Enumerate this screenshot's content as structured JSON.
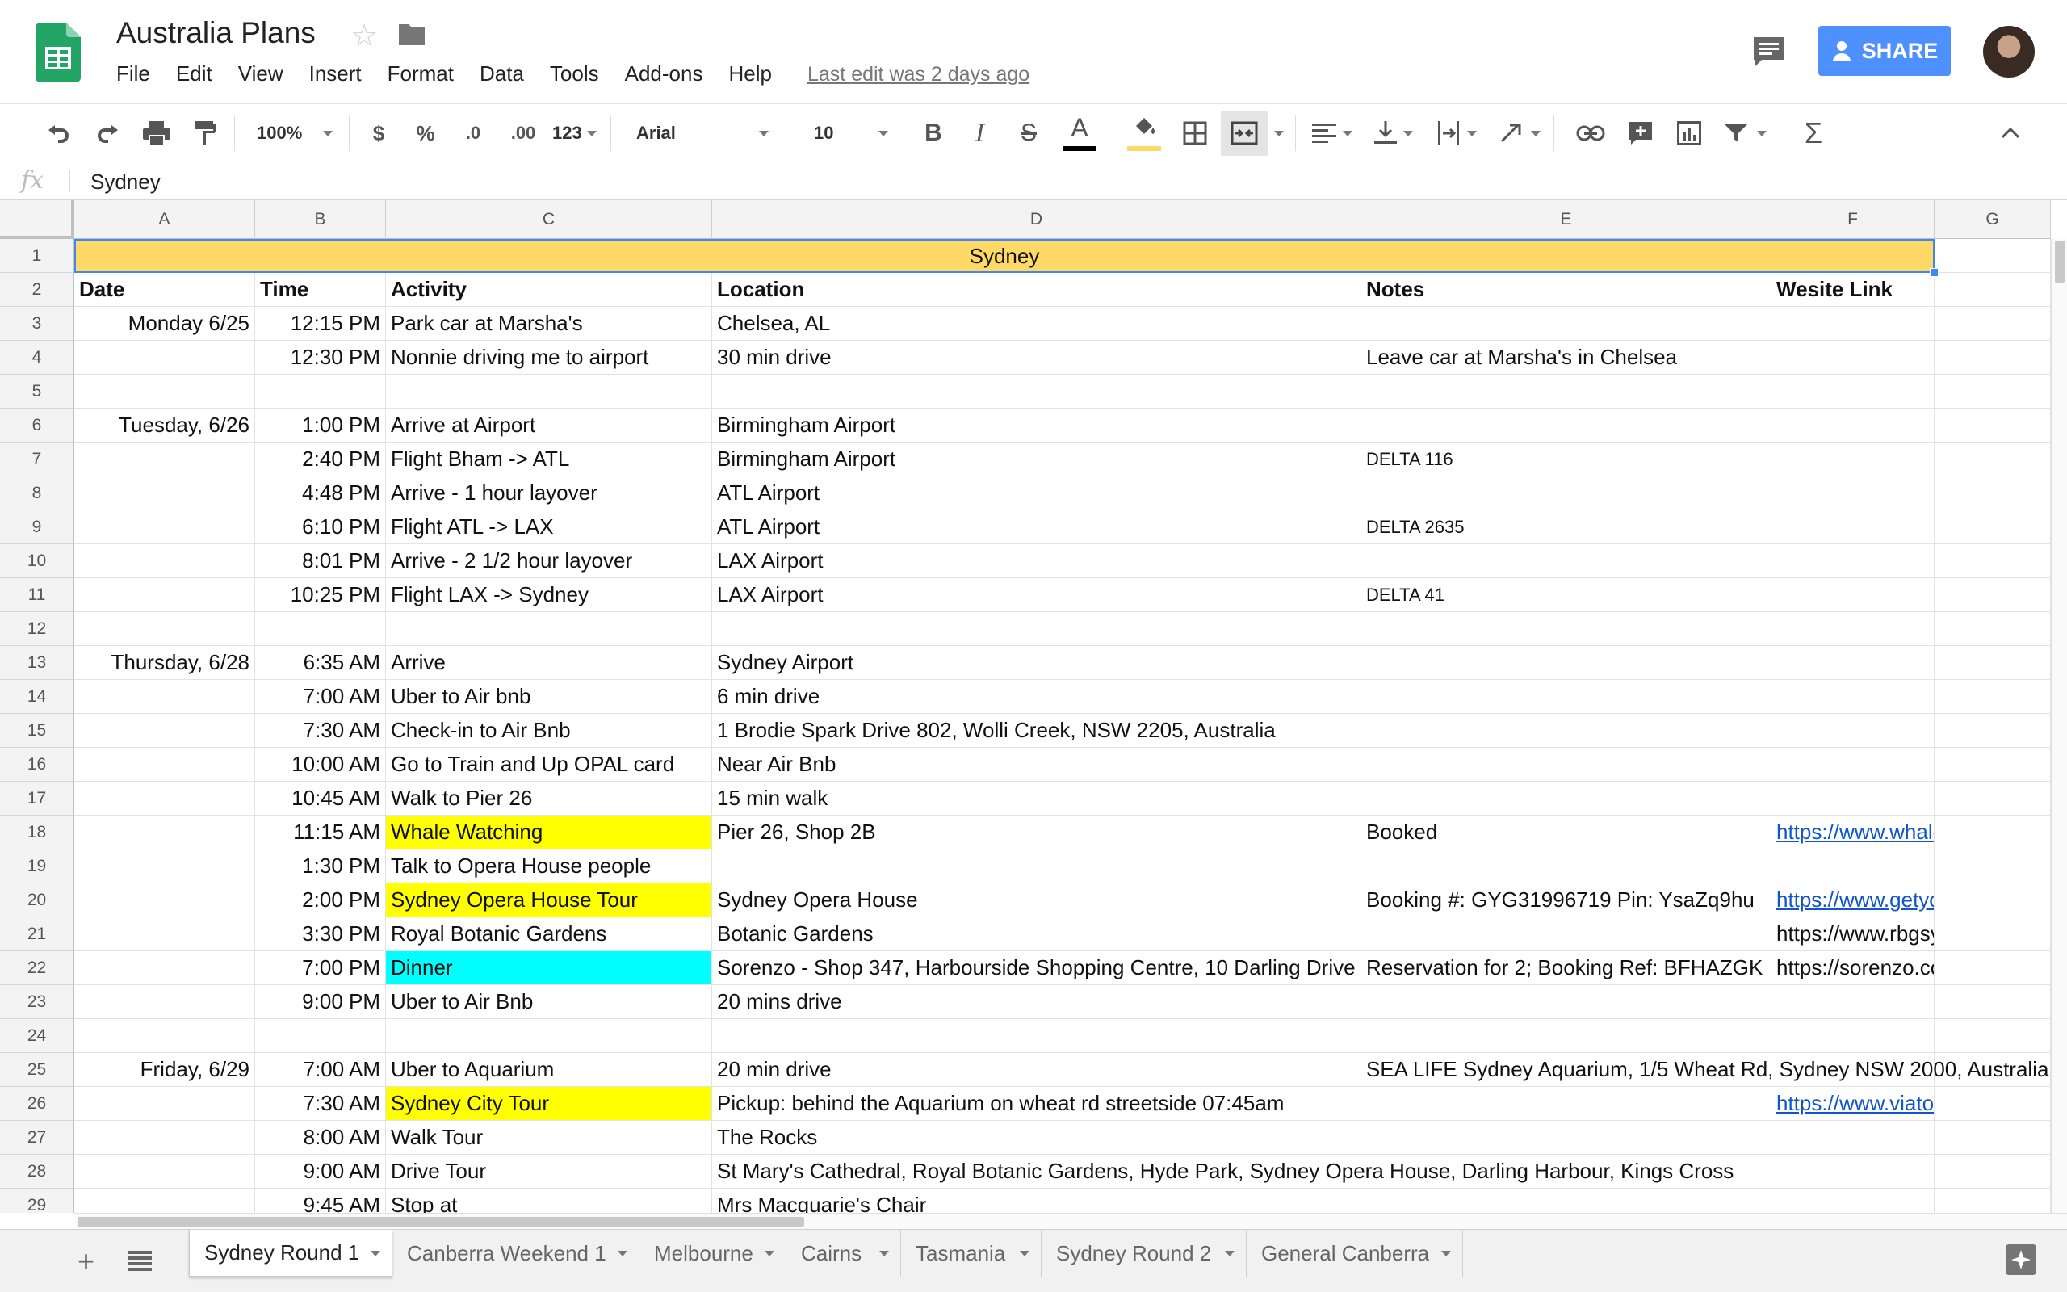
{
  "app": {
    "title": "Australia Plans",
    "last_edit": "Last edit was 2 days ago",
    "share_label": "SHARE",
    "menu": [
      "File",
      "Edit",
      "View",
      "Insert",
      "Format",
      "Data",
      "Tools",
      "Add-ons",
      "Help"
    ]
  },
  "toolbar": {
    "zoom": "100%",
    "currency": "$",
    "percent": "%",
    "decrease_decimals": ".0",
    "increase_decimals": ".00",
    "more_formats": "123",
    "font": "Arial",
    "font_size": "10",
    "text_color": "#000000",
    "fill_color": "#ffd966"
  },
  "formula_bar": {
    "fx": "fx",
    "value": "Sydney"
  },
  "columns": [
    "A",
    "B",
    "C",
    "D",
    "E",
    "F",
    "G"
  ],
  "rows": [
    "1",
    "2",
    "3",
    "4",
    "5",
    "6",
    "7",
    "8",
    "9",
    "10",
    "11",
    "12",
    "13",
    "14",
    "15",
    "16",
    "17",
    "18",
    "19",
    "20",
    "21",
    "22",
    "23",
    "24",
    "25",
    "26",
    "27",
    "28",
    "29"
  ],
  "sheet": {
    "title_row": "Sydney",
    "title_color": "#ffd966",
    "highlight_yellow": "#ffff00",
    "highlight_cyan": "#00ffff",
    "headers": {
      "date": "Date",
      "time": "Time",
      "activity": "Activity",
      "location": "Location",
      "notes": "Notes",
      "link": "Wesite Link"
    },
    "r3": {
      "date": "Monday 6/25",
      "time": "12:15 PM",
      "activity": "Park car at Marsha's",
      "location": "Chelsea, AL"
    },
    "r4": {
      "time": "12:30 PM",
      "activity": "Nonnie driving me to airport",
      "location": "30 min drive",
      "notes": "Leave car at Marsha's in Chelsea"
    },
    "r6": {
      "date": "Tuesday, 6/26",
      "time": "1:00 PM",
      "activity": "Arrive at Airport",
      "location": "Birmingham Airport"
    },
    "r7": {
      "time": "2:40 PM",
      "activity": "Flight Bham -> ATL",
      "location": "Birmingham Airport",
      "notes": "DELTA 116"
    },
    "r8": {
      "time": "4:48 PM",
      "activity": "Arrive - 1 hour layover",
      "location": "ATL Airport"
    },
    "r9": {
      "time": "6:10 PM",
      "activity": "Flight ATL -> LAX",
      "location": "ATL Airport",
      "notes": "DELTA 2635"
    },
    "r10": {
      "time": "8:01 PM",
      "activity": "Arrive - 2 1/2 hour layover",
      "location": "LAX Airport"
    },
    "r11": {
      "time": "10:25 PM",
      "activity": "Flight LAX -> Sydney",
      "location": "LAX Airport",
      "notes": "DELTA 41"
    },
    "r13": {
      "date": "Thursday, 6/28",
      "time": "6:35 AM",
      "activity": "Arrive",
      "location": "Sydney Airport"
    },
    "r14": {
      "time": "7:00 AM",
      "activity": "Uber to Air bnb",
      "location": "6 min drive"
    },
    "r15": {
      "time": "7:30 AM",
      "activity": "Check-in to Air Bnb",
      "location": "1 Brodie Spark Drive 802, Wolli Creek, NSW 2205, Australia"
    },
    "r16": {
      "time": "10:00 AM",
      "activity": "Go to Train and Up OPAL card",
      "location": "Near Air Bnb"
    },
    "r17": {
      "time": "10:45 AM",
      "activity": "Walk to Pier 26",
      "location": "15 min walk"
    },
    "r18": {
      "time": "11:15 AM",
      "activity": "Whale Watching",
      "location": "Pier 26, Shop 2B",
      "notes": "Booked",
      "link": "https://www.whalewatchingsy"
    },
    "r19": {
      "time": "1:30 PM",
      "activity": "Talk to Opera House people"
    },
    "r20": {
      "time": "2:00 PM",
      "activity": "Sydney Opera House Tour",
      "location": "Sydney Opera House",
      "notes": "Booking #: GYG31996719  Pin: YsaZq9hu",
      "link": "https://www.getyourguide.com"
    },
    "r21": {
      "time": "3:30 PM",
      "activity": "Royal Botanic Gardens",
      "location": "Botanic Gardens",
      "link": "https://www.rbgsyd.nsw.gov.a"
    },
    "r22": {
      "time": "7:00 PM",
      "activity": "Dinner",
      "location": "Sorenzo - Shop 347, Harbourside Shopping Centre, 10 Darling Drive",
      "notes": "Reservation for 2; Booking Ref: BFHAZGK",
      "link": "https://sorenzo.com.au/darling"
    },
    "r23": {
      "time": "9:00 PM",
      "activity": "Uber to Air Bnb",
      "location": "20 mins drive"
    },
    "r25": {
      "date": "Friday, 6/29",
      "time": "7:00 AM",
      "activity": "Uber to Aquarium",
      "location": "20 min drive",
      "notes": "SEA LIFE Sydney Aquarium, 1/5 Wheat Rd, Sydney NSW 2000, Australia"
    },
    "r26": {
      "time": "7:30 AM",
      "activity": "Sydney City Tour",
      "location": "Pickup: behind the Aquarium on wheat rd streetside 07:45am",
      "link": "https://www.viator.com/tours/S"
    },
    "r27": {
      "time": "8:00 AM",
      "activity": "Walk Tour",
      "location": "The Rocks"
    },
    "r28": {
      "time": "9:00 AM",
      "activity": "Drive Tour",
      "location": "St Mary's Cathedral, Royal Botanic Gardens, Hyde Park, Sydney Opera House, Darling Harbour, Kings Cross"
    },
    "r29": {
      "time": "9:45 AM",
      "activity": "Stop at",
      "location": "Mrs Macquarie's Chair"
    }
  },
  "tabs": [
    "Sydney Round 1",
    "Canberra Weekend 1",
    "Melbourne",
    "Cairns",
    "Tasmania",
    "Sydney Round 2",
    "General Canberra"
  ]
}
